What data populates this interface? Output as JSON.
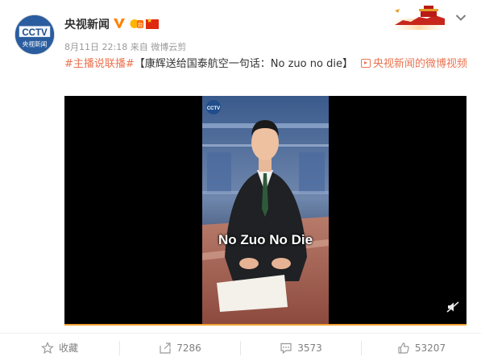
{
  "user": {
    "name": "央视新闻",
    "avatar_text": "央视新闻"
  },
  "meta": {
    "timestamp": "8月11日 22:18",
    "source_prefix": "来自",
    "source": "微博云剪"
  },
  "post": {
    "hashtag": "#主播说联播#",
    "text": "【康辉送给国泰航空一句话：No zuo no die】",
    "video_link": "央视新闻的微博视频"
  },
  "video": {
    "subtitle": "No Zuo No Die",
    "logo_text": "CCTV",
    "progress": 1.0
  },
  "actions": {
    "favorite": "收藏",
    "repost": "7286",
    "comment": "3573",
    "like": "53207"
  },
  "colors": {
    "link": "#eb7350",
    "meta": "#999999",
    "progress": "#f0a030"
  }
}
